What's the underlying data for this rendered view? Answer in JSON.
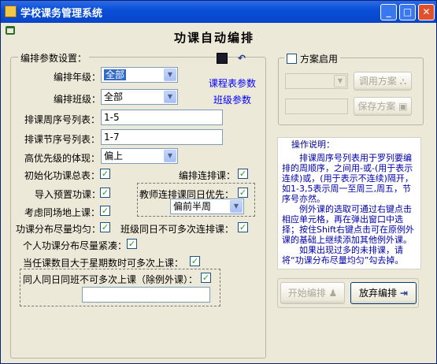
{
  "window": {
    "title": "学校课务管理系统"
  },
  "header": {
    "title": "功课自动编排"
  },
  "params": {
    "group_title": "编排参数设置：",
    "grade_label": "编排年级：",
    "grade_value": "全部",
    "class_label": "编排班级：",
    "class_value": "全部",
    "timetable_param_link": "课程表参数",
    "class_param_link": "班级参数",
    "weekday_seq_label": "排课周序号列表：",
    "weekday_seq_value": "1-5",
    "period_seq_label": "排课节序号列表：",
    "period_seq_value": "1-7",
    "priority_label": "高优先级的体现：",
    "priority_value": "偏上",
    "init_total_label": "初始化功课总表：",
    "consecutive_label": "编排连排课：",
    "import_preset_label": "导入预置功课：",
    "teacher_consecutive_label": "教师连排课同日优先：",
    "teacher_consecutive_value": "偏前半周",
    "same_venue_label": "考虑同场地上课：",
    "distribute_even_label": "功课分布尽量均匀：",
    "class_same_day_label": "班级同日不可多次连排课：",
    "personal_compact_label": "个人功课分布尽量紧凑：",
    "multi_per_day_label": "当任课数目大于星期数时可多次上课：",
    "no_repeat_label": "同人同日同班不可多次上课（除例外课）："
  },
  "plan": {
    "enable_label": "方案启用",
    "use_button": "调用方案",
    "save_button": "保存方案"
  },
  "help": {
    "title": "操作说明：",
    "p1": "排课周序号列表用于罗列要编排的周顺序，之间用-或-(用于表示连续)或，(用于表示不连续)隔开，如1-3,5表示周一至周三,周五，节序号亦然。",
    "p2": "例外课的选取可通过右键点击相应单元格，再在弹出窗口中选择；按住Shift右键点击可在原例外课的基础上继续添加其他例外课。",
    "p3": "如果出现过多的未排课，请将“功课分布尽量均匀”勾去掉。"
  },
  "actions": {
    "start_button": "开始编排",
    "abandon_button": "放弃编排"
  }
}
